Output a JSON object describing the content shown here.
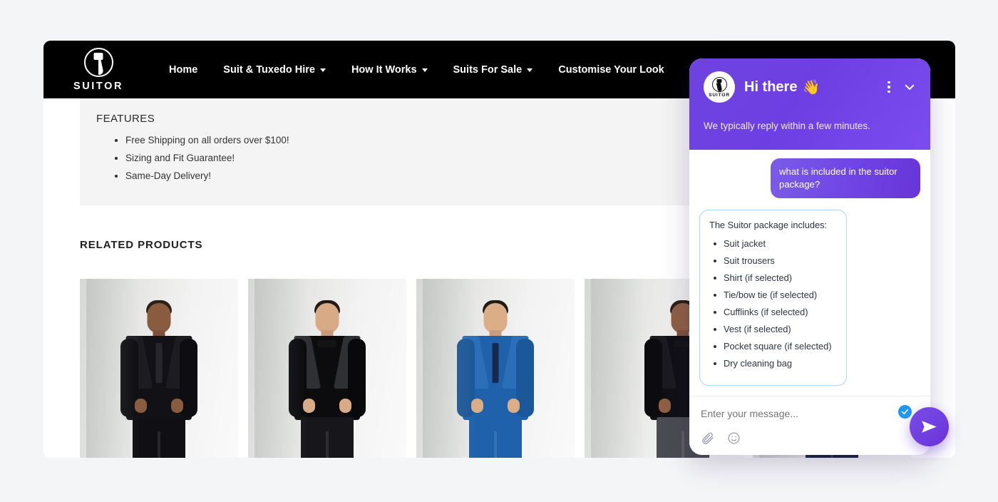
{
  "site": {
    "brand_name": "SUITOR",
    "brand_logo_icon": "suitor-circle-logo-icon",
    "nav": [
      {
        "label": "Home",
        "has_dropdown": false
      },
      {
        "label": "Suit & Tuxedo Hire",
        "has_dropdown": true
      },
      {
        "label": "How It Works",
        "has_dropdown": true
      },
      {
        "label": "Suits For Sale",
        "has_dropdown": true
      },
      {
        "label": "Customise Your Look",
        "has_dropdown": false
      }
    ]
  },
  "features": {
    "title": "FEATURES",
    "items": [
      "Free Shipping on all orders over $100!",
      "Sizing and Fit Guarantee!",
      "Same-Day Delivery!"
    ]
  },
  "related": {
    "title": "RELATED PRODUCTS",
    "products": [
      {
        "alt": "Man wearing black suit with black shirt and black tie"
      },
      {
        "alt": "Man wearing black velvet shawl-lapel tuxedo with black bow tie"
      },
      {
        "alt": "Man wearing blue suit with navy tie and white pocket square"
      },
      {
        "alt": "Man wearing black tuxedo jacket with bow tie and grey trousers"
      },
      {
        "alt": "Man wearing navy suit"
      }
    ]
  },
  "chat": {
    "avatar_icon": "suitor-avatar-icon",
    "avatar_label": "SUITOR",
    "title": "Hi there",
    "title_emoji": "👋",
    "subtitle": "We typically reply within a few minutes.",
    "menu_icon": "three-dots-vertical-icon",
    "collapse_icon": "chevron-down-icon",
    "messages": [
      {
        "role": "user",
        "text": "what is included in the suitor package?"
      },
      {
        "role": "bot",
        "lead": "The Suitor package includes:",
        "items": [
          "Suit jacket",
          "Suit trousers",
          "Shirt (if selected)",
          "Tie/bow tie (if selected)",
          "Cufflinks (if selected)",
          "Vest (if selected)",
          "Pocket square (if selected)",
          "Dry cleaning bag"
        ]
      }
    ],
    "input_placeholder": "Enter your message...",
    "input_value": "",
    "attach_icon": "paperclip-icon",
    "emoji_icon": "smiley-face-icon",
    "send_icon": "send-paper-plane-icon",
    "send_badge_icon": "check-badge-icon"
  },
  "colors": {
    "chat_accent": "#6d3fe2",
    "chat_send": "#6a33d8",
    "badge_blue": "#2196f3",
    "bot_border": "#a9d8ef",
    "nav_bg": "#000000",
    "page_bg": "#f4f5f7"
  }
}
